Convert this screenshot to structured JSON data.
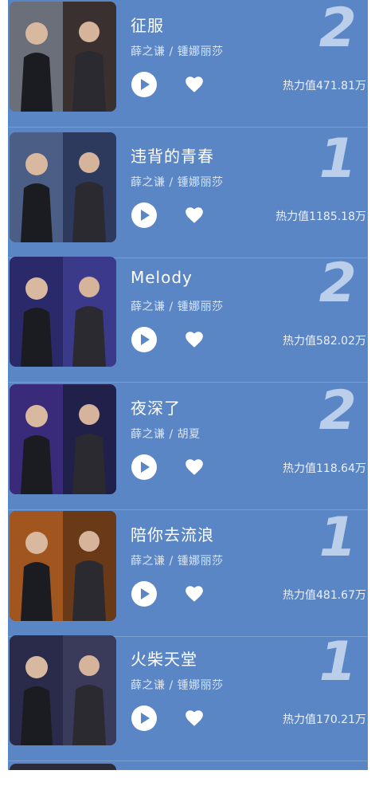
{
  "songs": [
    {
      "title": "征服",
      "artists": "薛之谦 / 锺娜丽莎",
      "rank": "2",
      "heat": "热力值471.81万",
      "cover_colors": [
        "#6b6f7a",
        "#3b3030"
      ]
    },
    {
      "title": "违背的青春",
      "artists": "薛之谦 / 锺娜丽莎",
      "rank": "1",
      "heat": "热力值1185.18万",
      "cover_colors": [
        "#4a5e86",
        "#2d3a5e"
      ]
    },
    {
      "title": "Melody",
      "artists": "薛之谦 / 锺娜丽莎",
      "rank": "2",
      "heat": "热力值582.02万",
      "cover_colors": [
        "#2a2a6a",
        "#3b3a8a"
      ]
    },
    {
      "title": "夜深了",
      "artists": "薛之谦 / 胡夏",
      "rank": "2",
      "heat": "热力值118.64万",
      "cover_colors": [
        "#3a2a7a",
        "#20204a"
      ]
    },
    {
      "title": "陪你去流浪",
      "artists": "薛之谦 / 锺娜丽莎",
      "rank": "1",
      "heat": "热力值481.67万",
      "cover_colors": [
        "#a0561e",
        "#6a3a18"
      ]
    },
    {
      "title": "火柴天堂",
      "artists": "薛之谦 / 锺娜丽莎",
      "rank": "1",
      "heat": "热力值170.21万",
      "cover_colors": [
        "#2a2a4a",
        "#3a3a5a"
      ]
    }
  ],
  "icons": {
    "play": "play-icon",
    "like": "heart-icon"
  },
  "colors": {
    "background": "#5a86c5",
    "rank_digit": "#e1ebfa"
  }
}
